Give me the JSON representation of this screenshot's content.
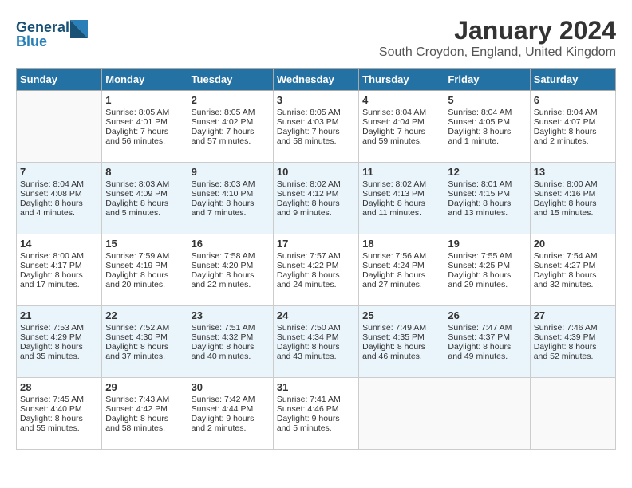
{
  "logo": {
    "line1": "General",
    "line2": "Blue"
  },
  "title": "January 2024",
  "subtitle": "South Croydon, England, United Kingdom",
  "days": [
    "Sunday",
    "Monday",
    "Tuesday",
    "Wednesday",
    "Thursday",
    "Friday",
    "Saturday"
  ],
  "weeks": [
    [
      {
        "day": "",
        "info": ""
      },
      {
        "day": "1",
        "info": "Sunrise: 8:05 AM\nSunset: 4:01 PM\nDaylight: 7 hours\nand 56 minutes."
      },
      {
        "day": "2",
        "info": "Sunrise: 8:05 AM\nSunset: 4:02 PM\nDaylight: 7 hours\nand 57 minutes."
      },
      {
        "day": "3",
        "info": "Sunrise: 8:05 AM\nSunset: 4:03 PM\nDaylight: 7 hours\nand 58 minutes."
      },
      {
        "day": "4",
        "info": "Sunrise: 8:04 AM\nSunset: 4:04 PM\nDaylight: 7 hours\nand 59 minutes."
      },
      {
        "day": "5",
        "info": "Sunrise: 8:04 AM\nSunset: 4:05 PM\nDaylight: 8 hours\nand 1 minute."
      },
      {
        "day": "6",
        "info": "Sunrise: 8:04 AM\nSunset: 4:07 PM\nDaylight: 8 hours\nand 2 minutes."
      }
    ],
    [
      {
        "day": "7",
        "info": "Sunrise: 8:04 AM\nSunset: 4:08 PM\nDaylight: 8 hours\nand 4 minutes."
      },
      {
        "day": "8",
        "info": "Sunrise: 8:03 AM\nSunset: 4:09 PM\nDaylight: 8 hours\nand 5 minutes."
      },
      {
        "day": "9",
        "info": "Sunrise: 8:03 AM\nSunset: 4:10 PM\nDaylight: 8 hours\nand 7 minutes."
      },
      {
        "day": "10",
        "info": "Sunrise: 8:02 AM\nSunset: 4:12 PM\nDaylight: 8 hours\nand 9 minutes."
      },
      {
        "day": "11",
        "info": "Sunrise: 8:02 AM\nSunset: 4:13 PM\nDaylight: 8 hours\nand 11 minutes."
      },
      {
        "day": "12",
        "info": "Sunrise: 8:01 AM\nSunset: 4:15 PM\nDaylight: 8 hours\nand 13 minutes."
      },
      {
        "day": "13",
        "info": "Sunrise: 8:00 AM\nSunset: 4:16 PM\nDaylight: 8 hours\nand 15 minutes."
      }
    ],
    [
      {
        "day": "14",
        "info": "Sunrise: 8:00 AM\nSunset: 4:17 PM\nDaylight: 8 hours\nand 17 minutes."
      },
      {
        "day": "15",
        "info": "Sunrise: 7:59 AM\nSunset: 4:19 PM\nDaylight: 8 hours\nand 20 minutes."
      },
      {
        "day": "16",
        "info": "Sunrise: 7:58 AM\nSunset: 4:20 PM\nDaylight: 8 hours\nand 22 minutes."
      },
      {
        "day": "17",
        "info": "Sunrise: 7:57 AM\nSunset: 4:22 PM\nDaylight: 8 hours\nand 24 minutes."
      },
      {
        "day": "18",
        "info": "Sunrise: 7:56 AM\nSunset: 4:24 PM\nDaylight: 8 hours\nand 27 minutes."
      },
      {
        "day": "19",
        "info": "Sunrise: 7:55 AM\nSunset: 4:25 PM\nDaylight: 8 hours\nand 29 minutes."
      },
      {
        "day": "20",
        "info": "Sunrise: 7:54 AM\nSunset: 4:27 PM\nDaylight: 8 hours\nand 32 minutes."
      }
    ],
    [
      {
        "day": "21",
        "info": "Sunrise: 7:53 AM\nSunset: 4:29 PM\nDaylight: 8 hours\nand 35 minutes."
      },
      {
        "day": "22",
        "info": "Sunrise: 7:52 AM\nSunset: 4:30 PM\nDaylight: 8 hours\nand 37 minutes."
      },
      {
        "day": "23",
        "info": "Sunrise: 7:51 AM\nSunset: 4:32 PM\nDaylight: 8 hours\nand 40 minutes."
      },
      {
        "day": "24",
        "info": "Sunrise: 7:50 AM\nSunset: 4:34 PM\nDaylight: 8 hours\nand 43 minutes."
      },
      {
        "day": "25",
        "info": "Sunrise: 7:49 AM\nSunset: 4:35 PM\nDaylight: 8 hours\nand 46 minutes."
      },
      {
        "day": "26",
        "info": "Sunrise: 7:47 AM\nSunset: 4:37 PM\nDaylight: 8 hours\nand 49 minutes."
      },
      {
        "day": "27",
        "info": "Sunrise: 7:46 AM\nSunset: 4:39 PM\nDaylight: 8 hours\nand 52 minutes."
      }
    ],
    [
      {
        "day": "28",
        "info": "Sunrise: 7:45 AM\nSunset: 4:40 PM\nDaylight: 8 hours\nand 55 minutes."
      },
      {
        "day": "29",
        "info": "Sunrise: 7:43 AM\nSunset: 4:42 PM\nDaylight: 8 hours\nand 58 minutes."
      },
      {
        "day": "30",
        "info": "Sunrise: 7:42 AM\nSunset: 4:44 PM\nDaylight: 9 hours\nand 2 minutes."
      },
      {
        "day": "31",
        "info": "Sunrise: 7:41 AM\nSunset: 4:46 PM\nDaylight: 9 hours\nand 5 minutes."
      },
      {
        "day": "",
        "info": ""
      },
      {
        "day": "",
        "info": ""
      },
      {
        "day": "",
        "info": ""
      }
    ]
  ]
}
